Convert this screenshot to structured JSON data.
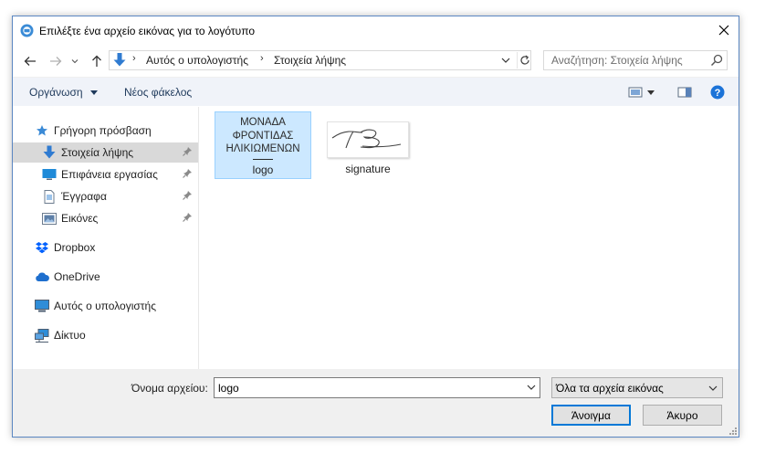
{
  "window": {
    "title": "Επιλέξτε ένα αρχείο εικόνας για το λογότυπο"
  },
  "navigation": {
    "breadcrumbs": [
      "Αυτός ο υπολογιστής",
      "Στοιχεία λήψης"
    ],
    "search_placeholder": "Αναζήτηση: Στοιχεία λήψης"
  },
  "toolbar": {
    "organize_label": "Οργάνωση",
    "new_folder_label": "Νέος φάκελος"
  },
  "sidebar": {
    "quick_access": "Γρήγορη πρόσβαση",
    "items": [
      {
        "label": "Στοιχεία λήψης",
        "icon": "download-icon",
        "pinned": true,
        "selected": true
      },
      {
        "label": "Επιφάνεια εργασίας",
        "icon": "desktop-icon",
        "pinned": true
      },
      {
        "label": "Έγγραφα",
        "icon": "documents-icon",
        "pinned": true
      },
      {
        "label": "Εικόνες",
        "icon": "pictures-icon",
        "pinned": true
      }
    ],
    "locations": [
      {
        "label": "Dropbox",
        "icon": "dropbox-icon"
      },
      {
        "label": "OneDrive",
        "icon": "onedrive-icon"
      },
      {
        "label": "Αυτός ο υπολογιστής",
        "icon": "computer-icon"
      },
      {
        "label": "Δίκτυο",
        "icon": "network-icon"
      }
    ]
  },
  "files": [
    {
      "name": "logo",
      "selected": true,
      "thumbnail_text": [
        "ΜΟΝΑΔΑ",
        "ΦΡΟΝΤΙΔΑΣ",
        "ΗΛΙΚΙΩΜΕΝΩΝ"
      ]
    },
    {
      "name": "signature",
      "selected": false
    }
  ],
  "bottom": {
    "filename_label": "Όνομα αρχείου:",
    "filename_value": "logo",
    "filetype_value": "Όλα τα αρχεία εικόνας",
    "open_label": "Άνοιγμα",
    "cancel_label": "Άκυρο"
  },
  "colors": {
    "accent": "#0078d7",
    "selection": "#cce8ff",
    "selection_border": "#99d1ff",
    "toolbar_bg": "#f0f3f9",
    "bottom_bg": "#f0f0f0"
  }
}
